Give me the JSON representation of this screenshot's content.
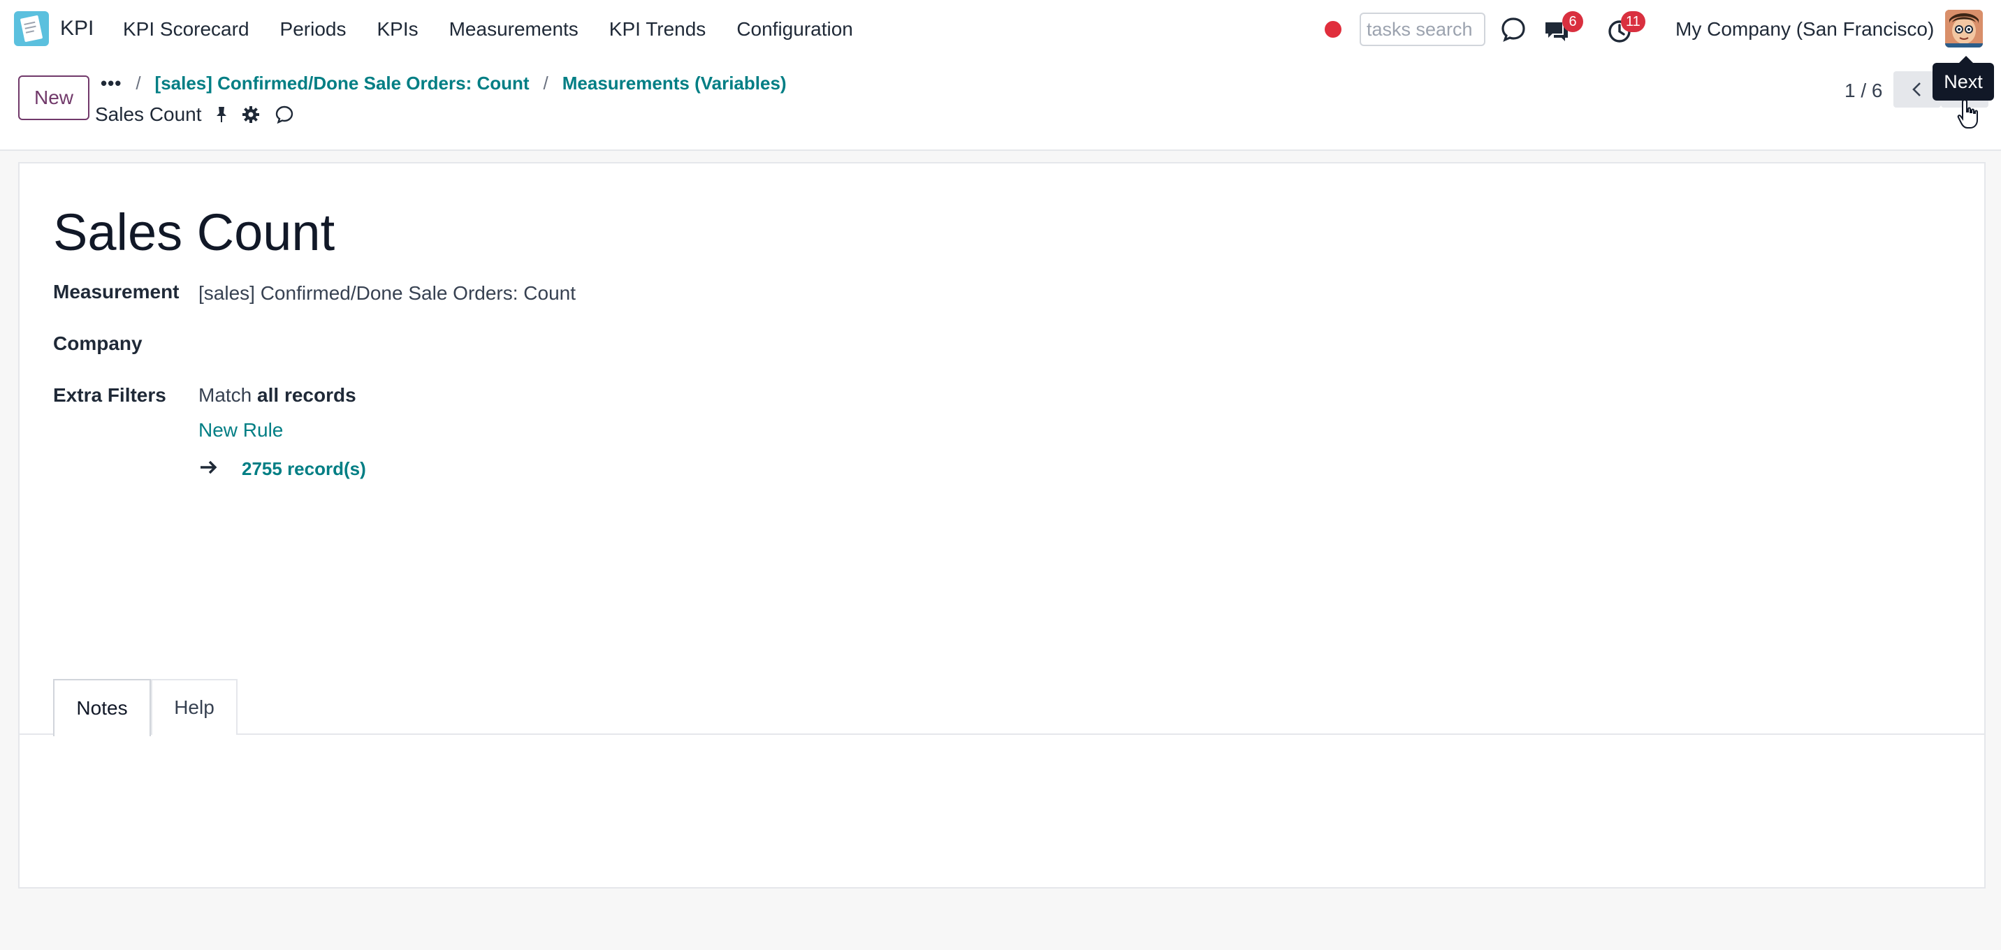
{
  "app": {
    "name": "KPI"
  },
  "menu": [
    {
      "label": "KPI Scorecard"
    },
    {
      "label": "Periods"
    },
    {
      "label": "KPIs"
    },
    {
      "label": "Measurements"
    },
    {
      "label": "KPI Trends"
    },
    {
      "label": "Configuration"
    }
  ],
  "systray": {
    "search_placeholder": "tasks search",
    "messages_count": "6",
    "activities_count": "11",
    "company": "My Company (San Francisco)"
  },
  "control_panel": {
    "new_label": "New",
    "breadcrumb_dots": "•••",
    "breadcrumb": [
      {
        "label": "[sales] Confirmed/Done Sale Orders: Count"
      },
      {
        "label": "Measurements (Variables)"
      }
    ],
    "record_title": "Sales Count",
    "pager": "1 / 6",
    "tooltip": "Next"
  },
  "form": {
    "title": "Sales Count",
    "fields": {
      "measurement_label": "Measurement",
      "measurement_value": "[sales] Confirmed/Done Sale Orders: Count",
      "company_label": "Company",
      "company_value": "",
      "extra_filters_label": "Extra Filters",
      "match_prefix": "Match",
      "match_value": "all records",
      "new_rule": "New Rule",
      "records_count": "2755 record(s)"
    },
    "tabs": [
      {
        "label": "Notes",
        "active": true
      },
      {
        "label": "Help",
        "active": false
      }
    ]
  },
  "colors": {
    "accent": "#017e84",
    "brand": "#71396a",
    "badge": "#d9303f"
  }
}
